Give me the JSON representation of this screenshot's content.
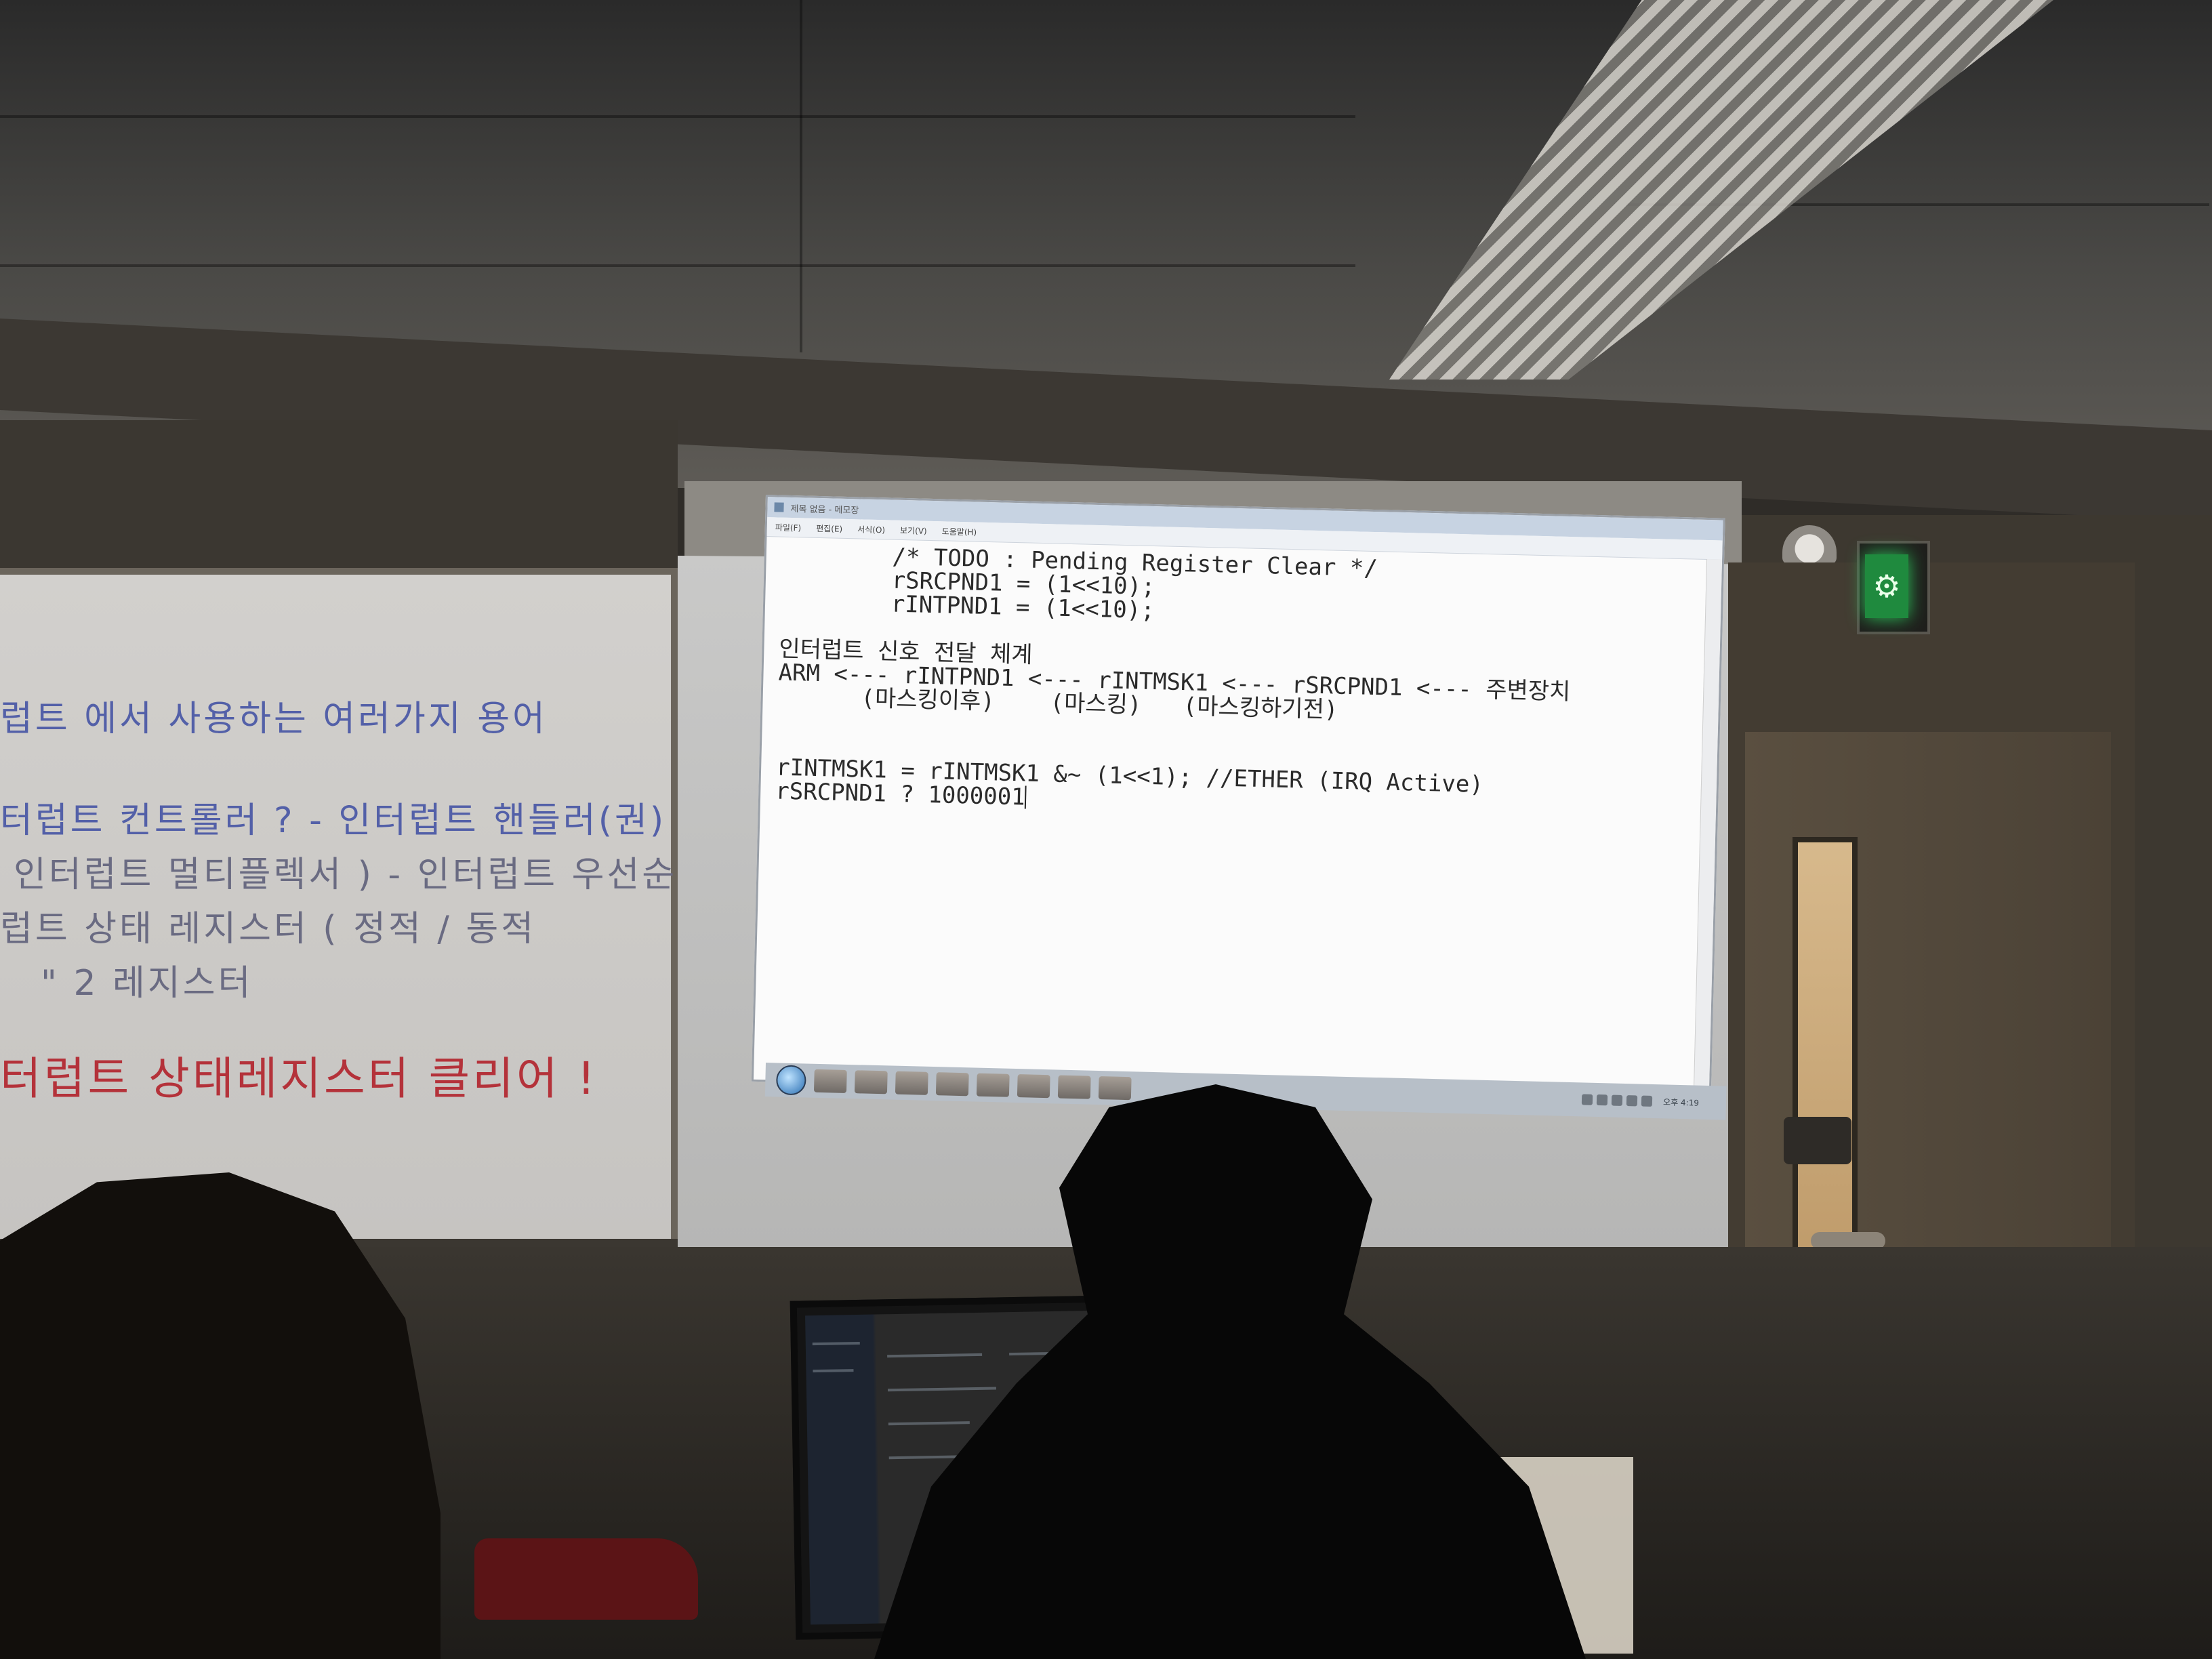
{
  "window": {
    "title": "제목 없음 - 메모장",
    "menu": [
      "파일(F)",
      "편집(E)",
      "서식(O)",
      "보기(V)",
      "도움말(H)"
    ],
    "code_lines": [
      "        /* TODO : Pending Register Clear */",
      "        rSRCPND1 = (1<<10);",
      "        rINTPND1 = (1<<10);",
      "",
      "인터럽트 신호 전달 체계",
      "ARM <--- rINTPND1 <--- rINTMSK1 <--- rSRCPND1 <--- 주변장치",
      "      (마스킹이후)    (마스킹)   (마스킹하기전)",
      "",
      "",
      "rINTMSK1 = rINTMSK1 &~ (1<<1); //ETHER (IRQ Active)",
      "rSRCPND1 ? 1000001"
    ]
  },
  "taskbar": {
    "clock": "오후 4:19"
  },
  "whiteboard": {
    "lines": [
      {
        "text": "럽트 에서   사용하는 여러가지 용어",
        "color": "blue"
      },
      {
        "text": "터럽트 컨트롤러 ?        - 인터럽트 핸들러(권)",
        "color": "blue"
      },
      {
        "text": "인터럽트 멀티플렉서 )    - 인터럽트 우선순위",
        "color": "gray"
      },
      {
        "text": "럽트 상태 레지스터          ( 정적 / 동적",
        "color": "gray"
      },
      {
        "text": "  \"      2 레지스터",
        "color": "gray"
      },
      {
        "text": "터럽트 상태레지스터 클리어 !",
        "color": "red"
      }
    ]
  },
  "colors": {
    "screen": "#fbfbfb",
    "whiteboard": "#cfcdca",
    "exit_sign": "#1f8a3e",
    "marker_blue": "#5360a8",
    "marker_red": "#b4323a"
  }
}
